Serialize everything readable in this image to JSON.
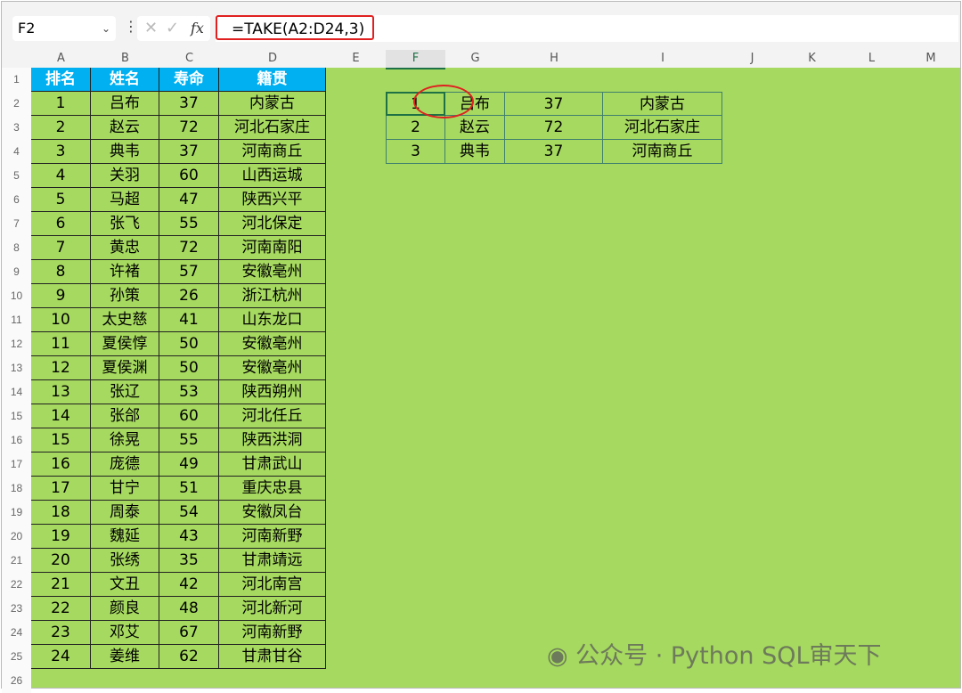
{
  "name_box": "F2",
  "formula": "=TAKE(A2:D24,3)",
  "columns": [
    "A",
    "B",
    "C",
    "D",
    "E",
    "F",
    "G",
    "H",
    "I",
    "J",
    "K",
    "L",
    "M"
  ],
  "headers": [
    "排名",
    "姓名",
    "寿命",
    "籍贯"
  ],
  "rows": [
    [
      "1",
      "吕布",
      "37",
      "内蒙古"
    ],
    [
      "2",
      "赵云",
      "72",
      "河北石家庄"
    ],
    [
      "3",
      "典韦",
      "37",
      "河南商丘"
    ],
    [
      "4",
      "关羽",
      "60",
      "山西运城"
    ],
    [
      "5",
      "马超",
      "47",
      "陕西兴平"
    ],
    [
      "6",
      "张飞",
      "55",
      "河北保定"
    ],
    [
      "7",
      "黄忠",
      "72",
      "河南南阳"
    ],
    [
      "8",
      "许褚",
      "57",
      "安徽亳州"
    ],
    [
      "9",
      "孙策",
      "26",
      "浙江杭州"
    ],
    [
      "10",
      "太史慈",
      "41",
      "山东龙口"
    ],
    [
      "11",
      "夏侯惇",
      "50",
      "安徽亳州"
    ],
    [
      "12",
      "夏侯渊",
      "50",
      "安徽亳州"
    ],
    [
      "13",
      "张辽",
      "53",
      "陕西朔州"
    ],
    [
      "14",
      "张郃",
      "60",
      "河北任丘"
    ],
    [
      "15",
      "徐晃",
      "55",
      "陕西洪洞"
    ],
    [
      "16",
      "庞德",
      "49",
      "甘肃武山"
    ],
    [
      "17",
      "甘宁",
      "51",
      "重庆忠县"
    ],
    [
      "18",
      "周泰",
      "54",
      "安徽凤台"
    ],
    [
      "19",
      "魏延",
      "43",
      "河南新野"
    ],
    [
      "20",
      "张绣",
      "35",
      "甘肃靖远"
    ],
    [
      "21",
      "文丑",
      "42",
      "河北南宫"
    ],
    [
      "22",
      "颜良",
      "48",
      "河北新河"
    ],
    [
      "23",
      "邓艾",
      "67",
      "河南新野"
    ],
    [
      "24",
      "姜维",
      "62",
      "甘肃甘谷"
    ]
  ],
  "result": [
    [
      "1",
      "吕布",
      "37",
      "内蒙古"
    ],
    [
      "2",
      "赵云",
      "72",
      "河北石家庄"
    ],
    [
      "3",
      "典韦",
      "37",
      "河南商丘"
    ]
  ],
  "watermark": "公众号 · Python SQL审天下"
}
